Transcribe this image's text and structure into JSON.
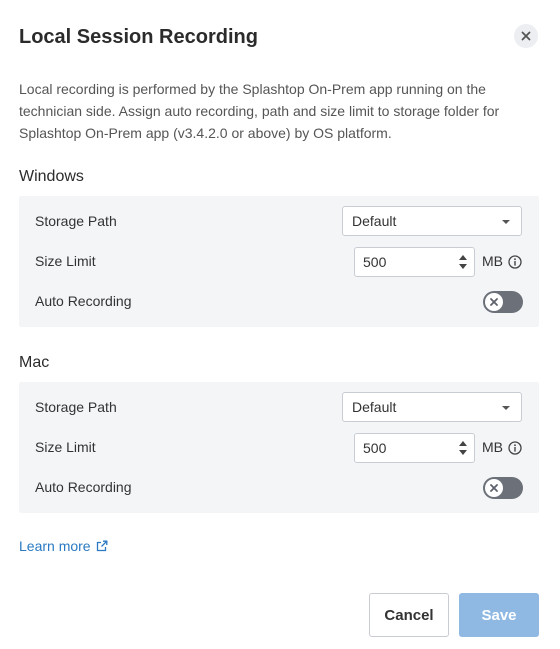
{
  "dialog": {
    "title": "Local Session Recording",
    "close_icon": "close-icon",
    "description": "Local recording is performed by the Splashtop On-Prem app running on the technician side. Assign auto recording, path and size limit to storage folder for Splashtop On-Prem app (v3.4.2.0 or above) by OS platform."
  },
  "windows": {
    "title": "Windows",
    "storage_path_label": "Storage Path",
    "storage_path_value": "Default",
    "size_limit_label": "Size Limit",
    "size_limit_value": "500",
    "size_unit": "MB",
    "auto_recording_label": "Auto Recording",
    "auto_recording_on": false
  },
  "mac": {
    "title": "Mac",
    "storage_path_label": "Storage Path",
    "storage_path_value": "Default",
    "size_limit_label": "Size Limit",
    "size_limit_value": "500",
    "size_unit": "MB",
    "auto_recording_label": "Auto Recording",
    "auto_recording_on": false
  },
  "footer": {
    "learn_more": "Learn more",
    "cancel": "Cancel",
    "save": "Save"
  },
  "colors": {
    "link": "#2a79c2",
    "save_disabled": "#8fb9e3",
    "toggle_off": "#6b7079",
    "panel_bg": "#f4f5f7"
  }
}
